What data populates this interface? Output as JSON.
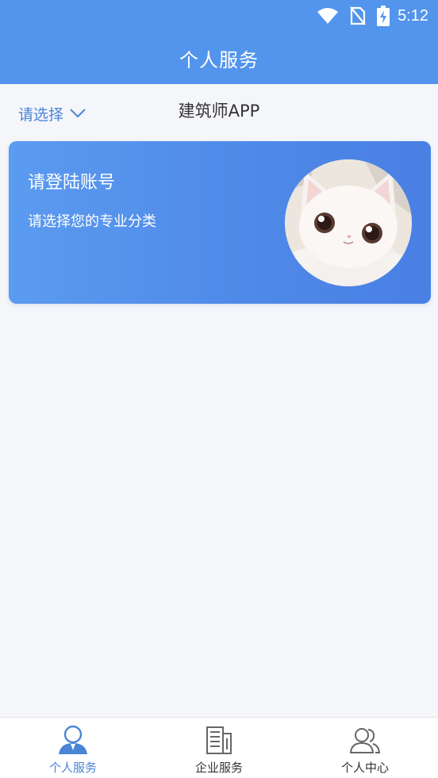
{
  "status_bar": {
    "time": "5:12",
    "icons": [
      "wifi-icon",
      "no-sim-icon",
      "battery-charging-icon"
    ]
  },
  "header": {
    "title": "个人服务"
  },
  "subbar": {
    "selector_label": "请选择",
    "selector_icon": "chevron-down-icon",
    "app_name": "建筑师APP"
  },
  "card": {
    "login_prompt": "请登陆账号",
    "category_prompt": "请选择您的专业分类",
    "avatar_icon": "cat-avatar"
  },
  "bottom_nav": {
    "items": [
      {
        "label": "个人服务",
        "icon": "person-icon",
        "active": true
      },
      {
        "label": "企业服务",
        "icon": "building-icon",
        "active": false
      },
      {
        "label": "个人中心",
        "icon": "users-icon",
        "active": false
      }
    ]
  },
  "colors": {
    "header_bg": "#5394ec",
    "accent": "#4a84d6",
    "page_bg": "#f4f6fa"
  }
}
